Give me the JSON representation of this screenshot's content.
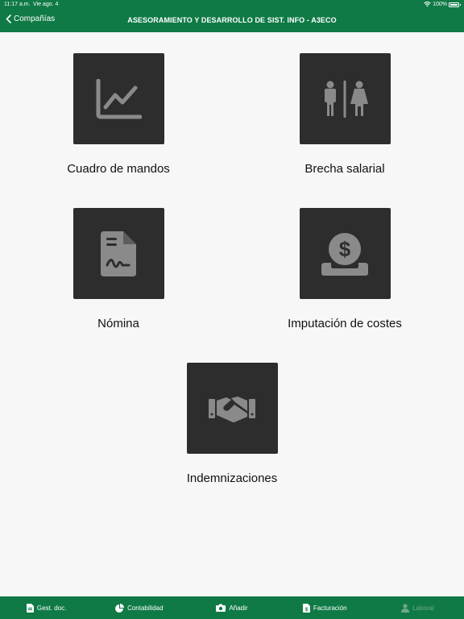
{
  "status_bar": {
    "time": "11:17 a.m.",
    "date": "Vie ago. 4",
    "battery": "100%"
  },
  "nav": {
    "back_label": "Compañías",
    "title": "ASESORAMIENTO Y DESARROLLO DE SIST. INFO - A3ECO"
  },
  "tiles": [
    {
      "label": "Cuadro de mandos",
      "icon": "chart-line-icon"
    },
    {
      "label": "Brecha salarial",
      "icon": "restroom-icon"
    },
    {
      "label": "Nómina",
      "icon": "payslip-icon"
    },
    {
      "label": "Imputación de costes",
      "icon": "coin-dollar-icon"
    },
    {
      "label": "Indemnizaciones",
      "icon": "handshake-icon"
    }
  ],
  "tabs": [
    {
      "label": "Gest. doc.",
      "icon": "document-icon"
    },
    {
      "label": "Contabilidad",
      "icon": "pie-chart-icon"
    },
    {
      "label": "Añadir",
      "icon": "camera-icon"
    },
    {
      "label": "Facturación",
      "icon": "invoice-icon"
    },
    {
      "label": "Laboral",
      "icon": "person-icon"
    }
  ]
}
